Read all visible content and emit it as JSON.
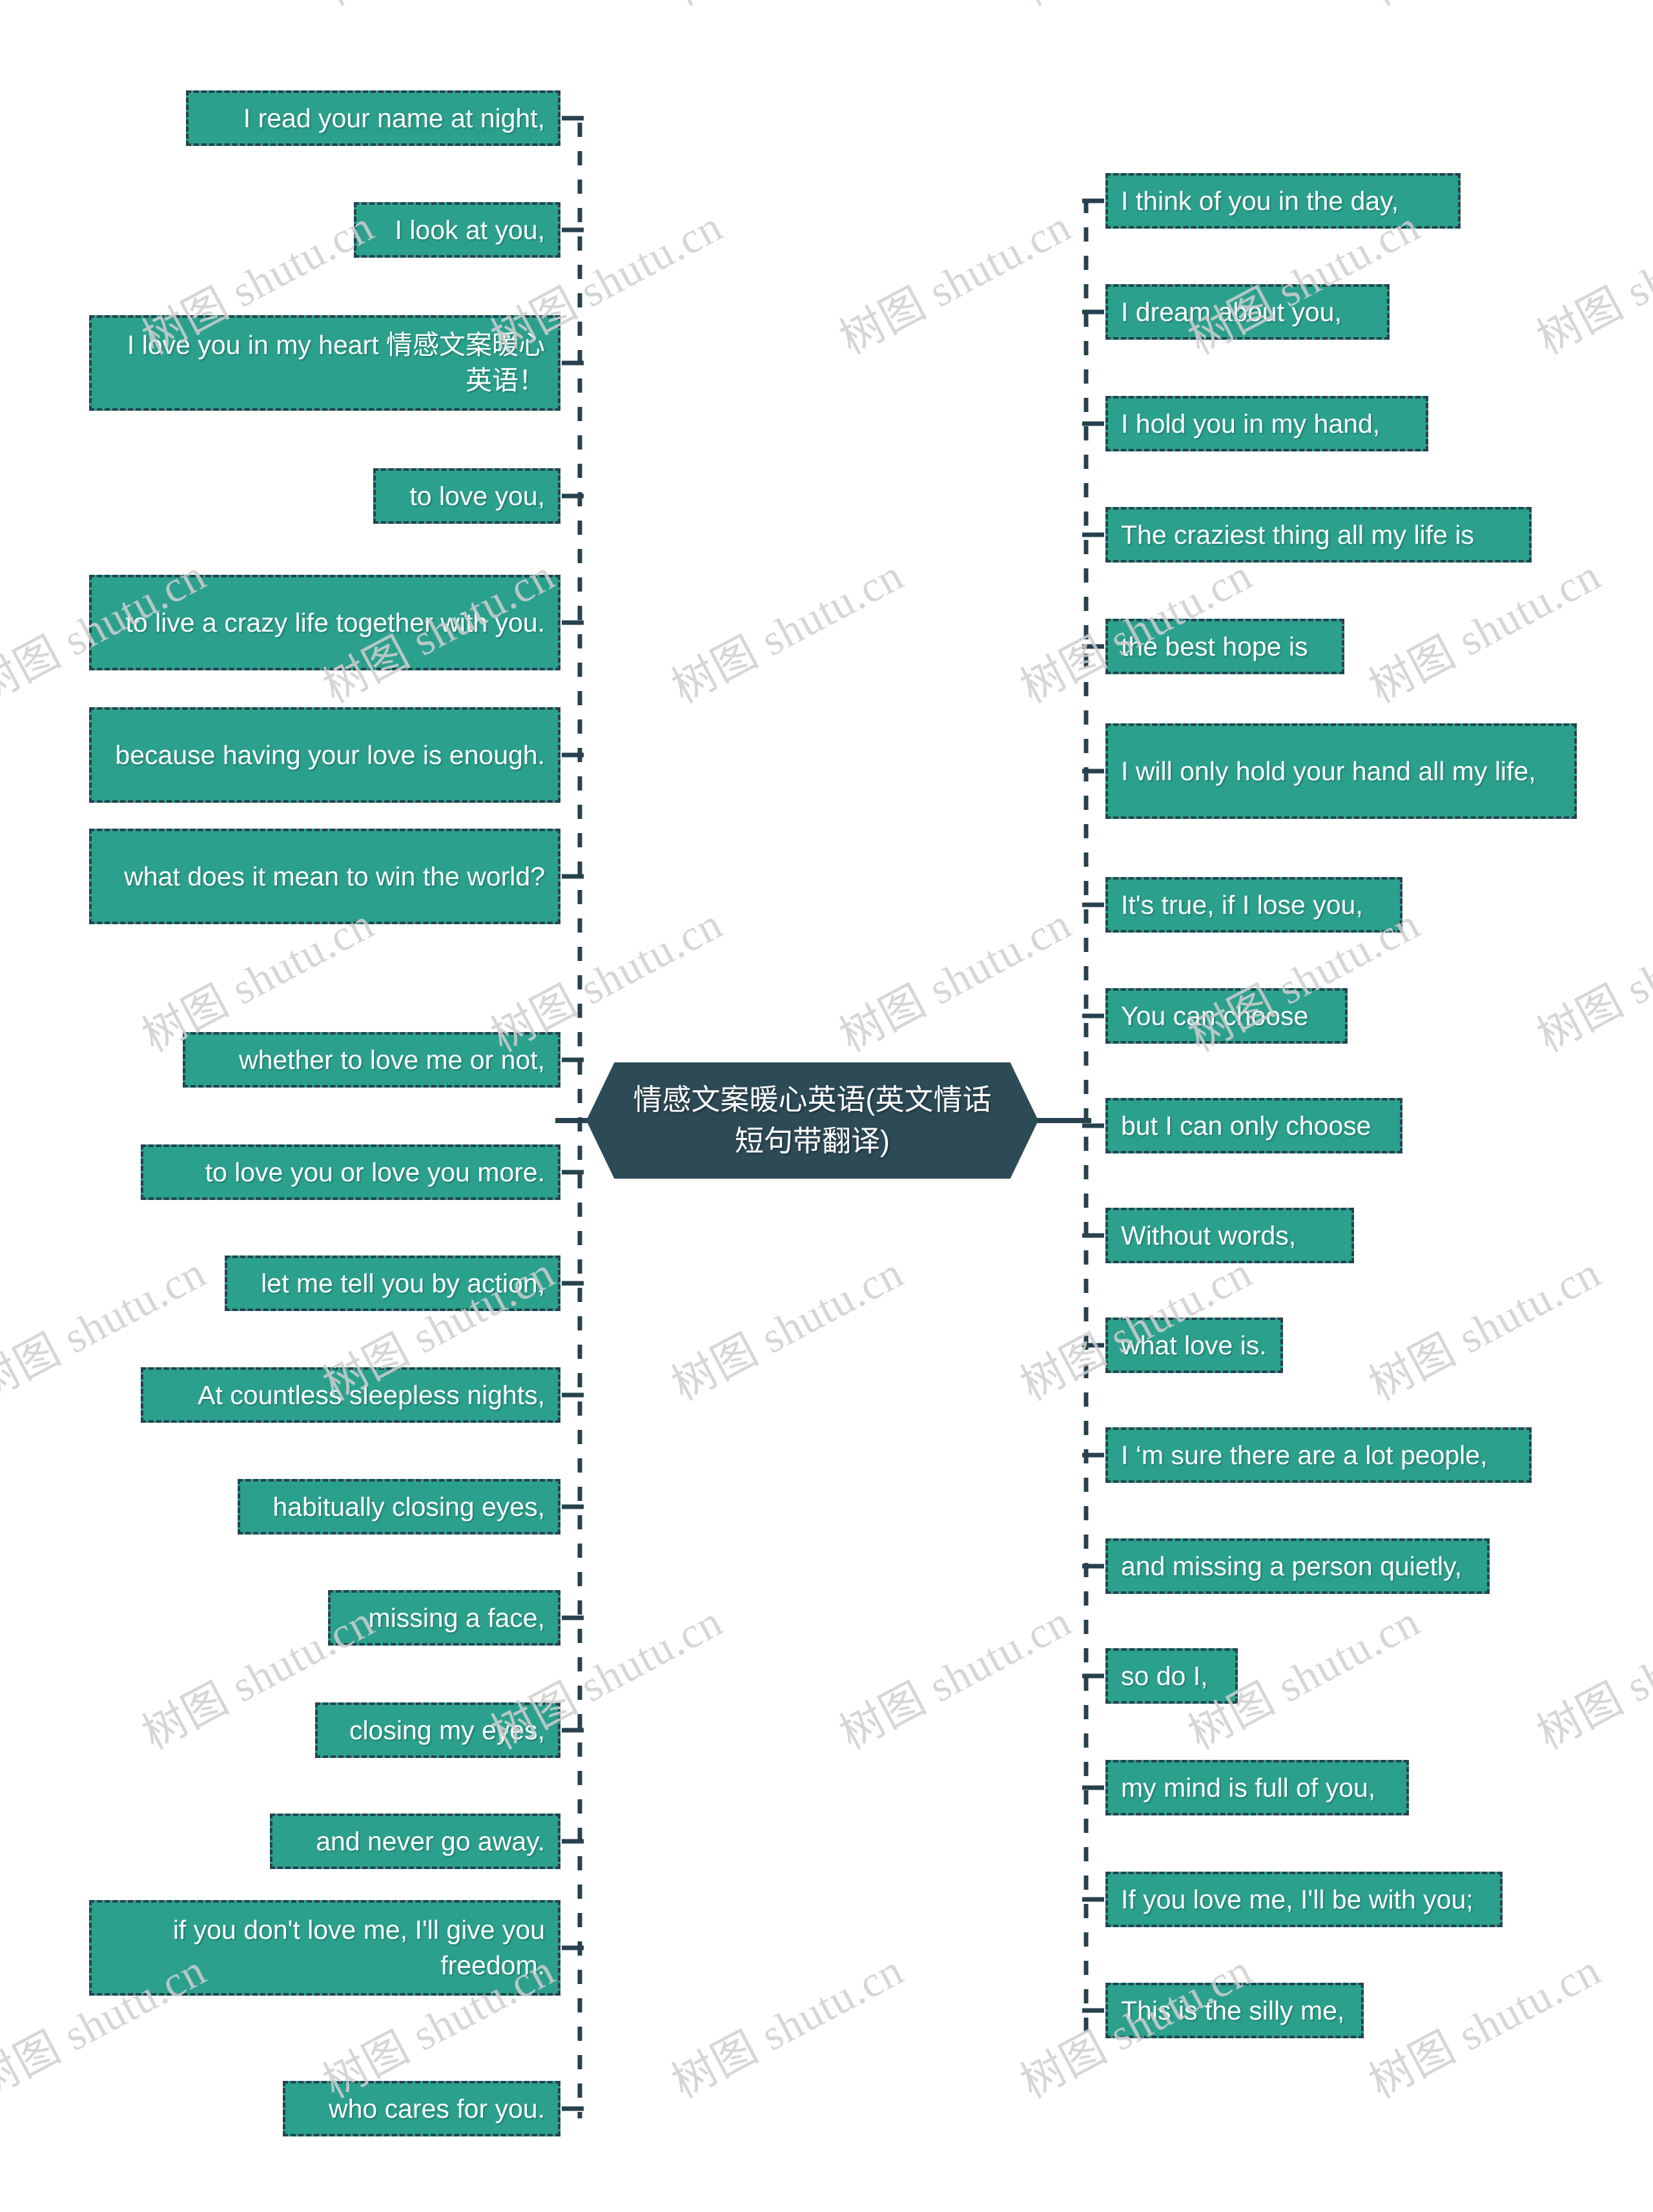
{
  "diagram": {
    "type": "mind-map",
    "orientation": "horizontal-two-sided",
    "colors": {
      "node_fill": "#2ba08d",
      "node_border": "#27414e",
      "node_text": "#ffffff",
      "root_fill": "#2d4a57",
      "connector": "#27414e",
      "background": "#ffffff",
      "watermark": "#cfcfcf"
    },
    "watermark_text": "树图 shutu.cn"
  },
  "root": {
    "label": "情感文案暖心英语(英文情话短句带翻译)",
    "shape": "hexagon"
  },
  "left_branch": {
    "side": "left",
    "items": [
      {
        "label": "I read your name at night,"
      },
      {
        "label": "I look at you,"
      },
      {
        "label": "I love you in my heart 情感文案暖心英语！"
      },
      {
        "label": "to love you,"
      },
      {
        "label": "to live a crazy life together with you."
      },
      {
        "label": "because having your love is enough."
      },
      {
        "label": "what does it mean to win the world?"
      },
      {
        "label": "whether to love me or not,"
      },
      {
        "label": "to love you or love you more."
      },
      {
        "label": "let me tell you by action,"
      },
      {
        "label": "At countless sleepless nights,"
      },
      {
        "label": "habitually closing eyes,"
      },
      {
        "label": "missing a face,"
      },
      {
        "label": "closing my eyes,"
      },
      {
        "label": "and never go away."
      },
      {
        "label": "if you don't love me, I'll give you freedom."
      },
      {
        "label": "who cares for you."
      }
    ]
  },
  "right_branch": {
    "side": "right",
    "items": [
      {
        "label": "I think of you in the day,"
      },
      {
        "label": "I dream about you,"
      },
      {
        "label": "I hold you in my hand,"
      },
      {
        "label": "The craziest thing all my life is"
      },
      {
        "label": "the best hope is"
      },
      {
        "label": "I will only hold your hand all my  life,"
      },
      {
        "label": "It's true, if I lose you,"
      },
      {
        "label": "You can choose"
      },
      {
        "label": "but I can only choose"
      },
      {
        "label": "Without words,"
      },
      {
        "label": "what love is."
      },
      {
        "label": "I  ‘m sure there are a lot people,"
      },
      {
        "label": "and missing a person quietly,"
      },
      {
        "label": "so do I,"
      },
      {
        "label": "my mind is full of you,"
      },
      {
        "label": "If you love me, I'll be with you;"
      },
      {
        "label": "This is the silly me,"
      }
    ]
  }
}
